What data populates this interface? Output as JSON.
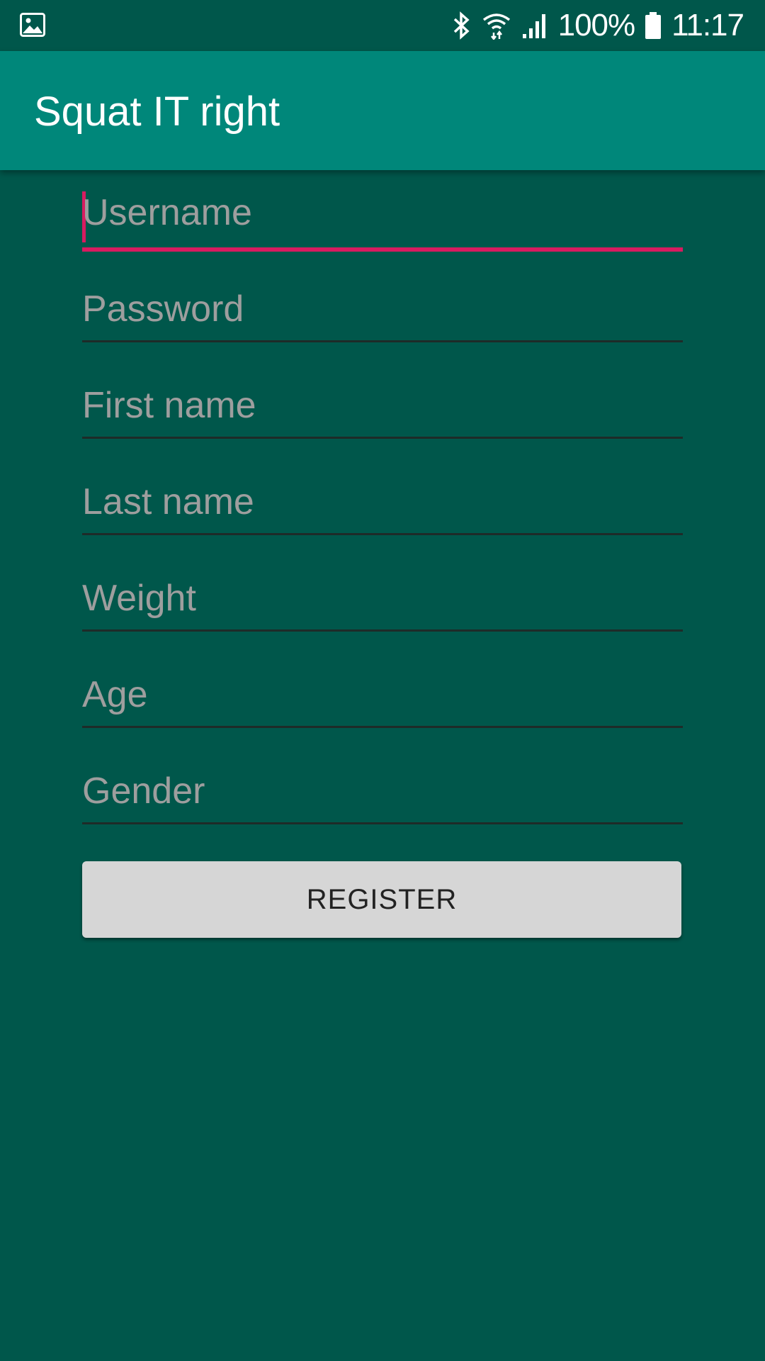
{
  "status_bar": {
    "left_icon": "image-notification-icon",
    "icons": [
      "bluetooth-icon",
      "wifi-icon",
      "signal-icon",
      "battery-icon"
    ],
    "battery_text": "100%",
    "time": "11:17"
  },
  "app_bar": {
    "title": "Squat IT right"
  },
  "form": {
    "fields": [
      {
        "placeholder": "Username",
        "value": ""
      },
      {
        "placeholder": "Password",
        "value": ""
      },
      {
        "placeholder": "First name",
        "value": ""
      },
      {
        "placeholder": "Last name",
        "value": ""
      },
      {
        "placeholder": "Weight",
        "value": ""
      },
      {
        "placeholder": "Age",
        "value": ""
      },
      {
        "placeholder": "Gender",
        "value": ""
      }
    ],
    "register_label": "REGISTER"
  },
  "colors": {
    "background": "#00574B",
    "app_bar": "#00877A",
    "accent": "#D81B60",
    "button": "#D6D6D6"
  }
}
